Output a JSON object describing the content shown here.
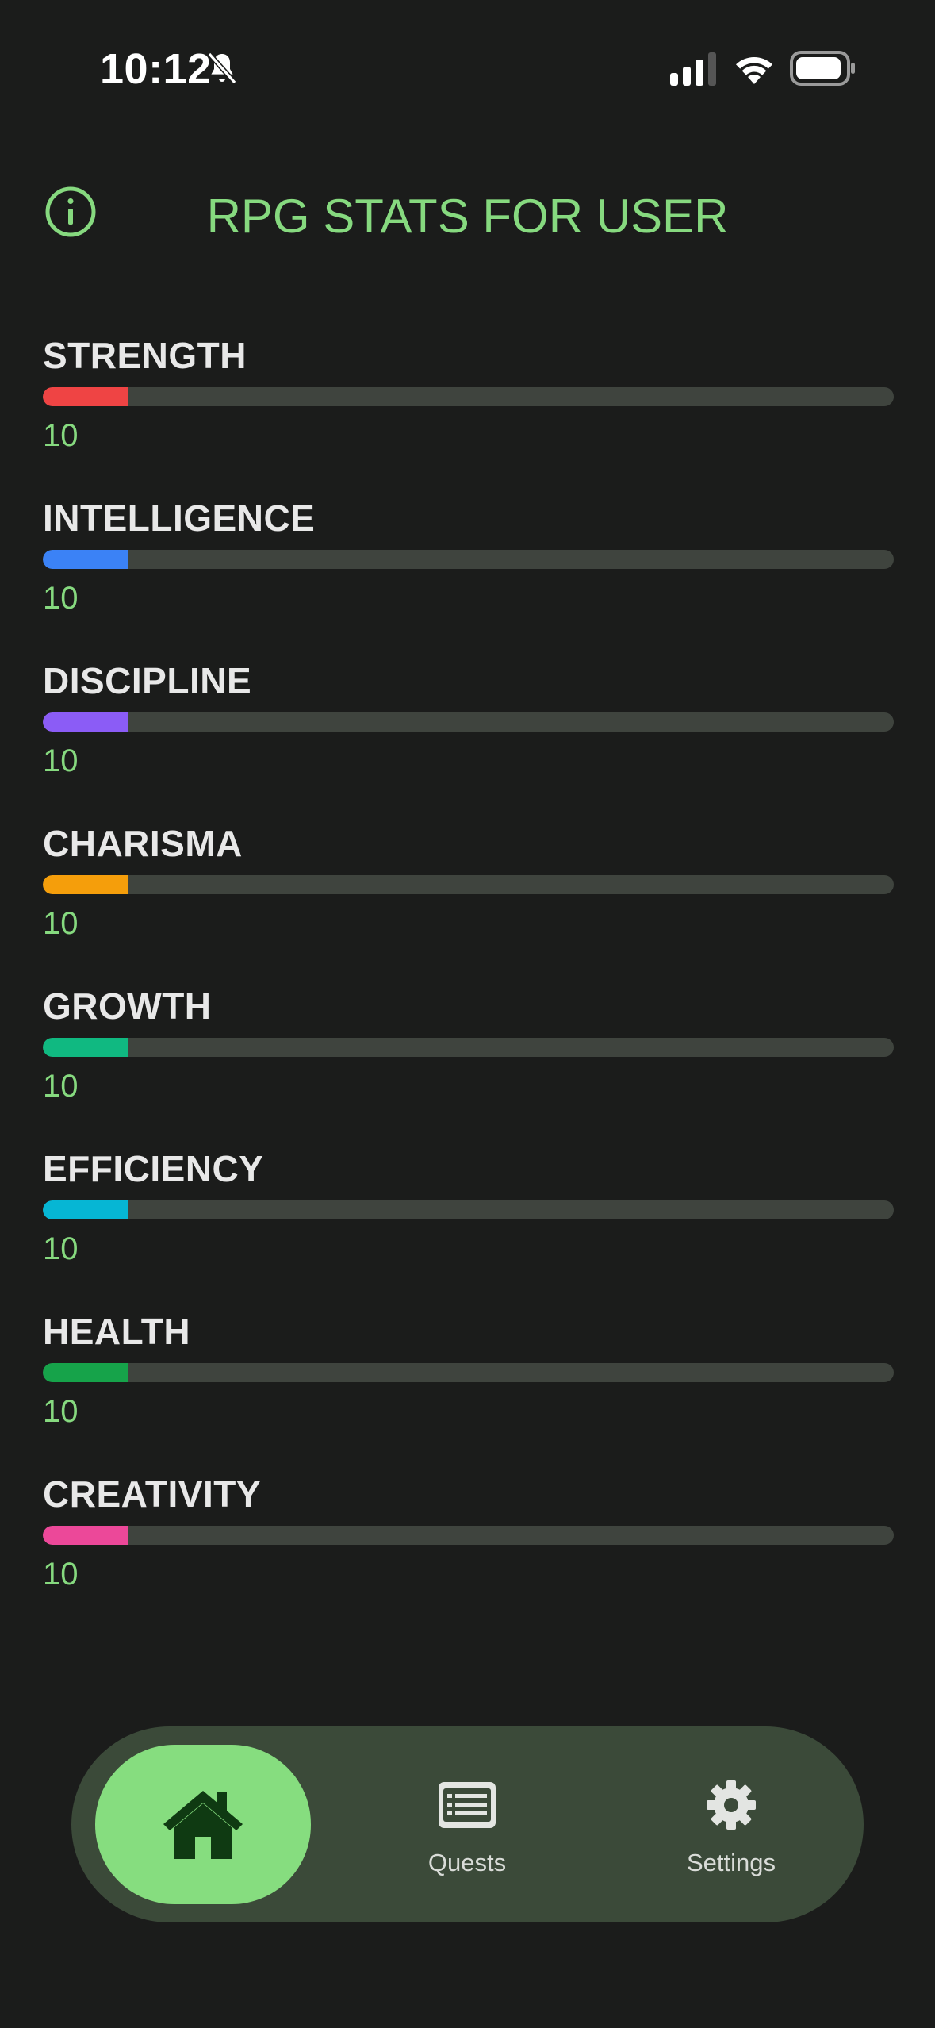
{
  "status_bar": {
    "time": "10:12",
    "icons": [
      "bell-slash-icon",
      "cellular-signal-icon",
      "wifi-icon",
      "battery-icon"
    ]
  },
  "header": {
    "title": "RPG STATS FOR USER",
    "info_icon": "info-circle-icon",
    "title_color": "#86d97f"
  },
  "stats": [
    {
      "name": "STRENGTH",
      "value": "10",
      "fill_fraction": 0.1,
      "color": "#ef4444"
    },
    {
      "name": "INTELLIGENCE",
      "value": "10",
      "fill_fraction": 0.1,
      "color": "#3b82f6"
    },
    {
      "name": "DISCIPLINE",
      "value": "10",
      "fill_fraction": 0.1,
      "color": "#8b5cf6"
    },
    {
      "name": "CHARISMA",
      "value": "10",
      "fill_fraction": 0.1,
      "color": "#f59e0b"
    },
    {
      "name": "GROWTH",
      "value": "10",
      "fill_fraction": 0.1,
      "color": "#10b981"
    },
    {
      "name": "EFFICIENCY",
      "value": "10",
      "fill_fraction": 0.1,
      "color": "#06b6d4"
    },
    {
      "name": "HEALTH",
      "value": "10",
      "fill_fraction": 0.1,
      "color": "#16a34a"
    },
    {
      "name": "CREATIVITY",
      "value": "10",
      "fill_fraction": 0.1,
      "color": "#ec4899"
    }
  ],
  "nav": {
    "home": {
      "icon": "home-icon",
      "active": true
    },
    "quests": {
      "label": "Quests",
      "icon": "list-card-icon"
    },
    "settings": {
      "label": "Settings",
      "icon": "gear-icon"
    }
  },
  "colors": {
    "background": "#1b1c1b",
    "accent": "#86d97f",
    "nav_background": "#3b4a39",
    "nav_active": "#86dd7f",
    "bar_track": "#3f443e"
  }
}
